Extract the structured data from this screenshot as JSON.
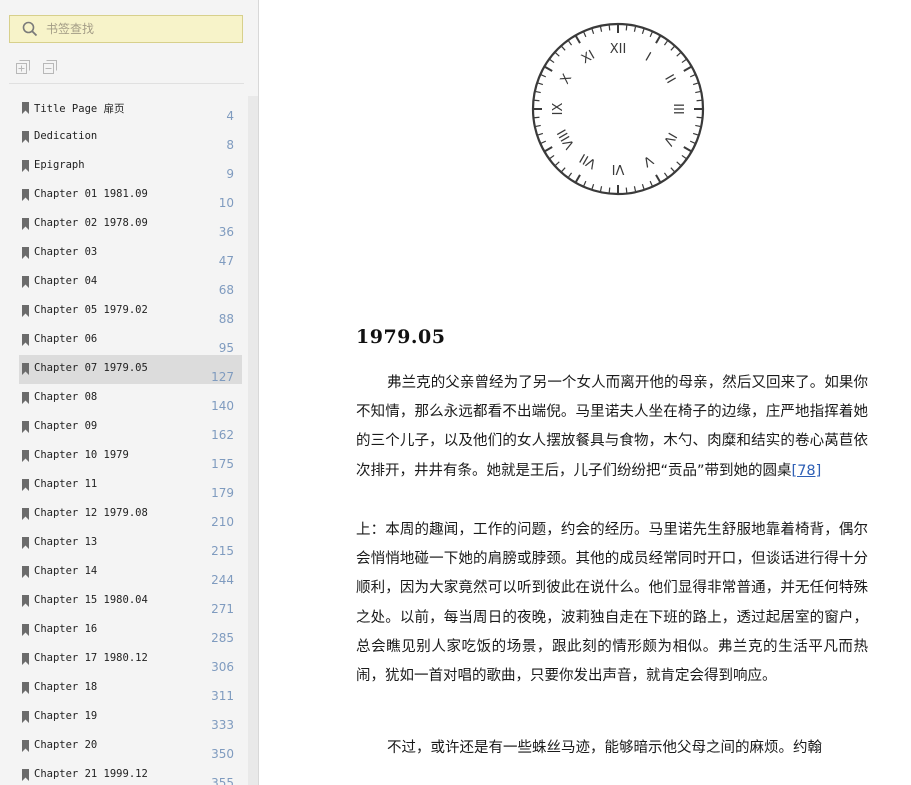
{
  "sidebar": {
    "search": {
      "placeholder": "书签查找"
    },
    "toolbar": {
      "expand_icon": "expand-all-icon",
      "collapse_icon": "collapse-all-icon"
    },
    "bookmarks": [
      {
        "label": "Title Page 扉页",
        "page": "4"
      },
      {
        "label": "Dedication",
        "page": "8"
      },
      {
        "label": "Epigraph",
        "page": "9"
      },
      {
        "label": "Chapter 01 1981.09",
        "page": "10"
      },
      {
        "label": "Chapter 02 1978.09",
        "page": "36"
      },
      {
        "label": "Chapter 03",
        "page": "47"
      },
      {
        "label": "Chapter 04",
        "page": "68"
      },
      {
        "label": "Chapter 05 1979.02",
        "page": "88"
      },
      {
        "label": "Chapter 06",
        "page": "95"
      },
      {
        "label": "Chapter 07 1979.05",
        "page": "127",
        "selected": true
      },
      {
        "label": "Chapter 08",
        "page": "140"
      },
      {
        "label": "Chapter 09",
        "page": "162"
      },
      {
        "label": "Chapter 10 1979",
        "page": "175"
      },
      {
        "label": "Chapter 11",
        "page": "179"
      },
      {
        "label": "Chapter 12 1979.08",
        "page": "210"
      },
      {
        "label": "Chapter 13",
        "page": "215"
      },
      {
        "label": "Chapter 14",
        "page": "244"
      },
      {
        "label": "Chapter 15 1980.04",
        "page": "271"
      },
      {
        "label": "Chapter 16",
        "page": "285"
      },
      {
        "label": "Chapter 17 1980.12",
        "page": "306"
      },
      {
        "label": "Chapter 18",
        "page": "311"
      },
      {
        "label": "Chapter 19",
        "page": "333"
      },
      {
        "label": "Chapter 20",
        "page": "350"
      },
      {
        "label": "Chapter 21 1999.12",
        "page": "355"
      }
    ]
  },
  "page": {
    "clock": {
      "icon": "clock-face-icon",
      "numerals": [
        "XII",
        "I",
        "II",
        "III",
        "IV",
        "V",
        "VI",
        "VII",
        "VIII",
        "IX",
        "X",
        "XI"
      ]
    },
    "heading": "1979.05",
    "paragraphs": {
      "p1_text": "弗兰克的父亲曾经为了另一个女人而离开他的母亲，然后又回来了。如果你不知情，那么永远都看不出端倪。马里诺夫人坐在椅子的边缘，庄严地指挥着她的三个儿子，以及他们的女人摆放餐具与食物，木勺、肉糜和结实的卷心莴苣依次排开，井井有条。她就是王后，儿子们纷纷把“贡品”带到她的圆桌",
      "p1_footnote": "[78]",
      "p2_text": "上：本周的趣闻，工作的问题，约会的经历。马里诺先生舒服地靠着椅背，偶尔会悄悄地碰一下她的肩膀或脖颈。其他的成员经常同时开口，但谈话进行得十分顺利，因为大家竟然可以听到彼此在说什么。他们显得非常普通，并无任何特殊之处。以前，每当周日的夜晚，波莉独自走在下班的路上，透过起居室的窗户，总会瞧见别人家吃饭的场景，跟此刻的情形颇为相似。弗兰克的生活平凡而热闹，犹如一首对唱的歌曲，只要你发出声音，就肯定会得到响应。",
      "p3_text": "不过，或许还是有一些蛛丝马迹，能够暗示他父母之间的麻烦。约翰"
    }
  },
  "colors": {
    "search_bg": "#f7f3c9",
    "selected_row": "#dcdcdc",
    "page_number": "#7f9bbf",
    "footnote_link": "#2e5fb5"
  }
}
